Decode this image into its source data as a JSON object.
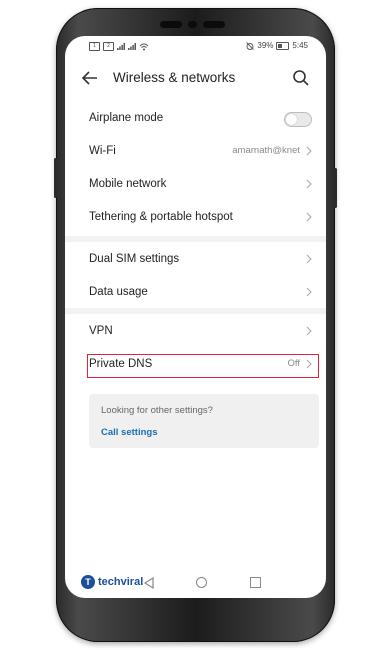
{
  "status_bar": {
    "left_icons": [
      "sim-1-icon",
      "sim-2-icon",
      "signal-icon",
      "signal-icon",
      "wifi-icon"
    ],
    "battery": "39%",
    "time": "5:45"
  },
  "header": {
    "title": "Wireless & networks",
    "back_icon": "back-arrow-icon",
    "search_icon": "search-icon"
  },
  "group1": [
    {
      "label": "Airplane mode",
      "type": "toggle",
      "on": false
    },
    {
      "label": "Wi-Fi",
      "value": "amarnath@knet"
    },
    {
      "label": "Mobile network"
    },
    {
      "label": "Tethering & portable hotspot"
    }
  ],
  "group2": [
    {
      "label": "Dual SIM settings"
    },
    {
      "label": "Data usage"
    }
  ],
  "group3": [
    {
      "label": "VPN"
    },
    {
      "label": "Private DNS",
      "value": "Off",
      "highlighted": true
    }
  ],
  "suggestion": {
    "hint": "Looking for other settings?",
    "link": "Call settings"
  },
  "watermark": {
    "logo_letter": "T",
    "text": "techviral"
  },
  "colors": {
    "highlight": "#e0233a",
    "link": "#1a6fb0",
    "watermark": "#1b4f9c"
  }
}
